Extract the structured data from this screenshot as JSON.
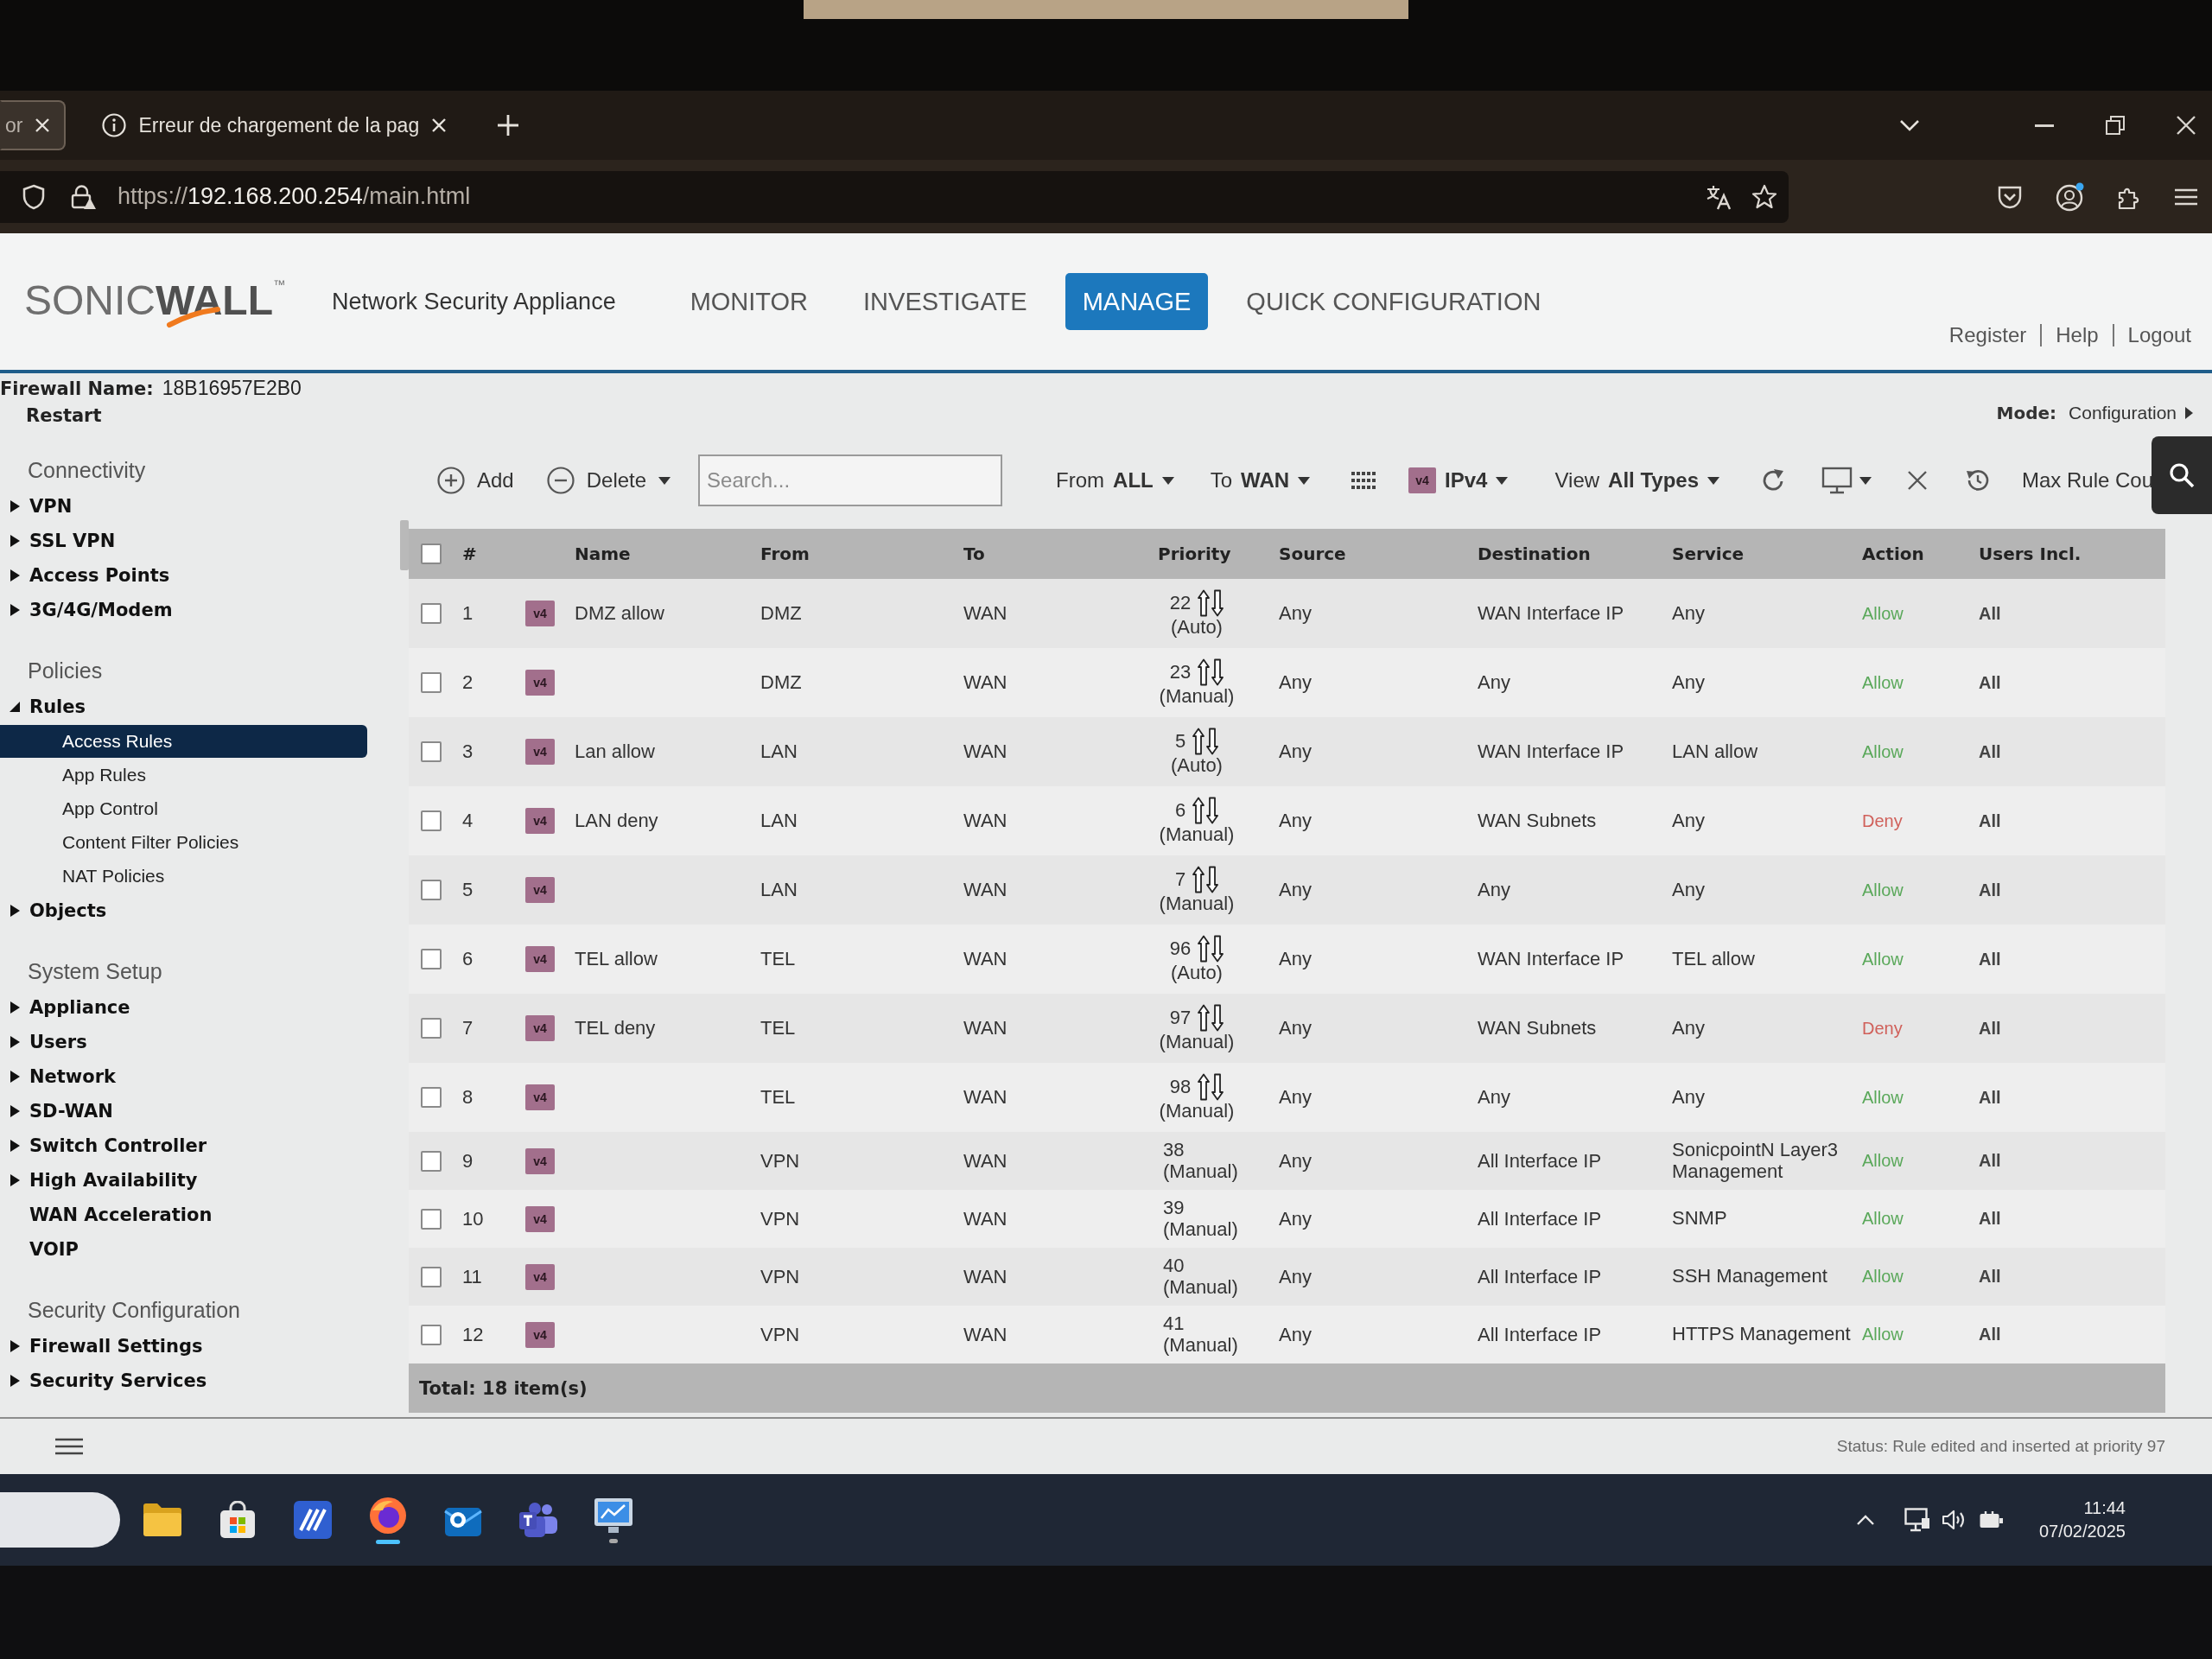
{
  "browser": {
    "tabs": [
      {
        "title": "or",
        "kind": "page",
        "selected": true
      },
      {
        "title": "Erreur de chargement de la pag",
        "kind": "error",
        "selected": false
      }
    ],
    "url": {
      "scheme": "https://",
      "host": "192.168.200.254",
      "path": "/main.html"
    }
  },
  "header": {
    "logo": {
      "light": "SONIC",
      "bold": "WALL",
      "mark": "™"
    },
    "subtitle": "Network Security Appliance",
    "nav": [
      {
        "label": "MONITOR",
        "selected": false
      },
      {
        "label": "INVESTIGATE",
        "selected": false
      },
      {
        "label": "MANAGE",
        "selected": true
      },
      {
        "label": "QUICK CONFIGURATION",
        "selected": false
      }
    ],
    "links": [
      "Register",
      "Help",
      "Logout"
    ]
  },
  "info": {
    "firewall_label": "Firewall Name:",
    "firewall_name": "18B16957E2B0",
    "restart": "Restart",
    "mode_label": "Mode:",
    "mode": "Configuration"
  },
  "sidebar": {
    "sections": [
      {
        "title": "Connectivity",
        "items": [
          {
            "label": "VPN",
            "kind": "group",
            "expanded": false,
            "selected": false
          },
          {
            "label": "SSL VPN",
            "kind": "group",
            "expanded": false,
            "selected": false
          },
          {
            "label": "Access Points",
            "kind": "group",
            "expanded": false,
            "selected": false
          },
          {
            "label": "3G/4G/Modem",
            "kind": "group",
            "expanded": false,
            "selected": false
          }
        ]
      },
      {
        "title": "Policies",
        "items": [
          {
            "label": "Rules",
            "kind": "group",
            "expanded": true,
            "selected": false,
            "children": [
              {
                "label": "Access Rules",
                "selected": true
              },
              {
                "label": "App Rules",
                "selected": false
              },
              {
                "label": "App Control",
                "selected": false
              },
              {
                "label": "Content Filter Policies",
                "selected": false
              },
              {
                "label": "NAT Policies",
                "selected": false
              }
            ]
          },
          {
            "label": "Objects",
            "kind": "group",
            "expanded": false,
            "selected": false
          }
        ]
      },
      {
        "title": "System Setup",
        "items": [
          {
            "label": "Appliance",
            "kind": "group",
            "expanded": false,
            "selected": false
          },
          {
            "label": "Users",
            "kind": "group",
            "expanded": false,
            "selected": false
          },
          {
            "label": "Network",
            "kind": "group",
            "expanded": false,
            "selected": false
          },
          {
            "label": "SD-WAN",
            "kind": "group",
            "expanded": false,
            "selected": false
          },
          {
            "label": "Switch Controller",
            "kind": "group",
            "expanded": false,
            "selected": false
          },
          {
            "label": "High Availability",
            "kind": "group",
            "expanded": false,
            "selected": false
          },
          {
            "label": "WAN Acceleration",
            "kind": "leaf",
            "selected": false
          },
          {
            "label": "VOIP",
            "kind": "leaf",
            "selected": false
          }
        ]
      },
      {
        "title": "Security Configuration",
        "items": [
          {
            "label": "Firewall Settings",
            "kind": "group",
            "expanded": false,
            "selected": false
          },
          {
            "label": "Security Services",
            "kind": "group",
            "expanded": false,
            "selected": false
          }
        ]
      }
    ]
  },
  "toolbar": {
    "add": "Add",
    "delete": "Delete",
    "search": {
      "placeholder": "Search..."
    },
    "from": {
      "label": "From",
      "value": "ALL"
    },
    "to": {
      "label": "To",
      "value": "WAN"
    },
    "ip": {
      "badge": "v4",
      "value": "IPv4"
    },
    "view": {
      "label": "View",
      "value": "All Types"
    },
    "max_rule": "Max Rule Cou"
  },
  "table": {
    "all_checked": false,
    "columns": [
      "#",
      "Name",
      "From",
      "To",
      "Priority",
      "Source",
      "Destination",
      "Service",
      "Action",
      "Users Incl."
    ],
    "rows": [
      {
        "checked": false,
        "number": "1",
        "badge": "v4",
        "name": "DMZ allow",
        "from": "DMZ",
        "to": "WAN",
        "priority": "22",
        "priority_mode": "(Auto)",
        "reorder": true,
        "source": "Any",
        "destination": "WAN Interface IP",
        "service": "Any",
        "action": {
          "label": "Allow",
          "color": "#5aa85a"
        },
        "users": "All"
      },
      {
        "checked": false,
        "number": "2",
        "badge": "v4",
        "from": "DMZ",
        "to": "WAN",
        "priority": "23",
        "priority_mode": "(Manual)",
        "reorder": true,
        "source": "Any",
        "destination": "Any",
        "service": "Any",
        "action": {
          "label": "Allow",
          "color": "#5aa85a"
        },
        "users": "All"
      },
      {
        "checked": false,
        "number": "3",
        "badge": "v4",
        "name": "Lan allow",
        "from": "LAN",
        "to": "WAN",
        "priority": "5",
        "priority_mode": "(Auto)",
        "reorder": true,
        "source": "Any",
        "destination": "WAN Interface IP",
        "service": "LAN allow",
        "action": {
          "label": "Allow",
          "color": "#5aa85a"
        },
        "users": "All"
      },
      {
        "checked": false,
        "number": "4",
        "badge": "v4",
        "name": "LAN deny",
        "from": "LAN",
        "to": "WAN",
        "priority": "6",
        "priority_mode": "(Manual)",
        "reorder": true,
        "source": "Any",
        "destination": "WAN Subnets",
        "service": "Any",
        "action": {
          "label": "Deny",
          "color": "#d0605a"
        },
        "users": "All"
      },
      {
        "checked": false,
        "number": "5",
        "badge": "v4",
        "from": "LAN",
        "to": "WAN",
        "priority": "7",
        "priority_mode": "(Manual)",
        "reorder": true,
        "source": "Any",
        "destination": "Any",
        "service": "Any",
        "action": {
          "label": "Allow",
          "color": "#5aa85a"
        },
        "users": "All"
      },
      {
        "checked": false,
        "number": "6",
        "badge": "v4",
        "name": "TEL allow",
        "from": "TEL",
        "to": "WAN",
        "priority": "96",
        "priority_mode": "(Auto)",
        "reorder": true,
        "source": "Any",
        "destination": "WAN Interface IP",
        "service": "TEL allow",
        "action": {
          "label": "Allow",
          "color": "#5aa85a"
        },
        "users": "All"
      },
      {
        "checked": false,
        "number": "7",
        "badge": "v4",
        "name": "TEL deny",
        "from": "TEL",
        "to": "WAN",
        "priority": "97",
        "priority_mode": "(Manual)",
        "reorder": true,
        "source": "Any",
        "destination": "WAN Subnets",
        "service": "Any",
        "action": {
          "label": "Deny",
          "color": "#d0605a"
        },
        "users": "All"
      },
      {
        "checked": false,
        "number": "8",
        "badge": "v4",
        "from": "TEL",
        "to": "WAN",
        "priority": "98",
        "priority_mode": "(Manual)",
        "reorder": true,
        "source": "Any",
        "destination": "Any",
        "service": "Any",
        "action": {
          "label": "Allow",
          "color": "#5aa85a"
        },
        "users": "All"
      },
      {
        "checked": false,
        "number": "9",
        "badge": "v4",
        "from": "VPN",
        "to": "WAN",
        "priority": "38",
        "priority_mode": "(Manual)",
        "reorder": false,
        "source": "Any",
        "destination": "All Interface IP",
        "service": "SonicpointN Layer3 Management",
        "action": {
          "label": "Allow",
          "color": "#5aa85a"
        },
        "users": "All"
      },
      {
        "checked": false,
        "number": "10",
        "badge": "v4",
        "from": "VPN",
        "to": "WAN",
        "priority": "39",
        "priority_mode": "(Manual)",
        "reorder": false,
        "source": "Any",
        "destination": "All Interface IP",
        "service": "SNMP",
        "action": {
          "label": "Allow",
          "color": "#5aa85a"
        },
        "users": "All"
      },
      {
        "checked": false,
        "number": "11",
        "badge": "v4",
        "from": "VPN",
        "to": "WAN",
        "priority": "40",
        "priority_mode": "(Manual)",
        "reorder": false,
        "source": "Any",
        "destination": "All Interface IP",
        "service": "SSH Management",
        "action": {
          "label": "Allow",
          "color": "#5aa85a"
        },
        "users": "All"
      },
      {
        "checked": false,
        "number": "12",
        "badge": "v4",
        "from": "VPN",
        "to": "WAN",
        "priority": "41",
        "priority_mode": "(Manual)",
        "reorder": false,
        "source": "Any",
        "destination": "All Interface IP",
        "service": "HTTPS Management",
        "action": {
          "label": "Allow",
          "color": "#5aa85a"
        },
        "users": "All"
      }
    ],
    "total": "Total: 18 item(s)"
  },
  "status_bar": {
    "text": "Status: Rule edited and inserted at priority 97"
  },
  "taskbar": {
    "apps": [
      {
        "kind": "folder",
        "open": false,
        "active": false
      },
      {
        "kind": "store",
        "open": false,
        "active": false
      },
      {
        "kind": "tile",
        "open": false,
        "active": false
      },
      {
        "kind": "browser",
        "open": true,
        "active": true
      },
      {
        "kind": "mail",
        "open": false,
        "active": false
      },
      {
        "kind": "people",
        "open": false,
        "active": false
      },
      {
        "kind": "remote",
        "open": true,
        "active": false
      }
    ],
    "time": "11:44",
    "date": "07/02/2025"
  }
}
